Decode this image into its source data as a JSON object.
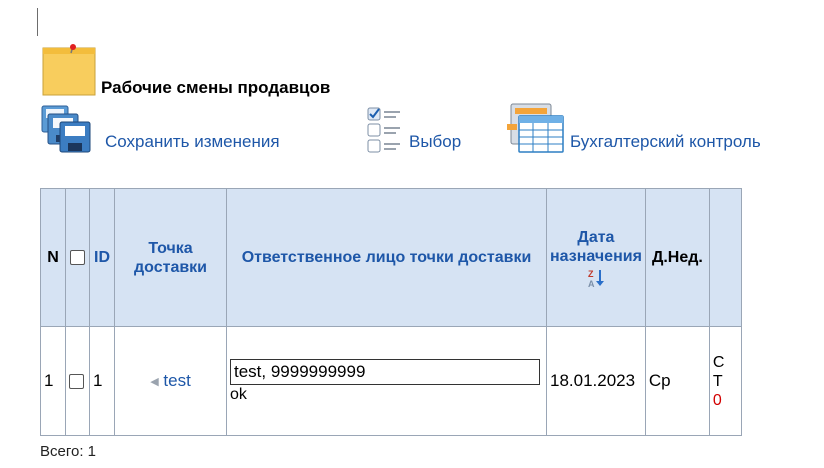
{
  "page": {
    "title": "Рабочие смены продавцов"
  },
  "toolbar": {
    "save_label": "Сохранить изменения",
    "select_label": "Выбор",
    "accounting_label": "Бухгалтерский контроль"
  },
  "table": {
    "headers": {
      "n": "N",
      "id": "ID",
      "point": "Точка доставки",
      "responsible": "Ответственное лицо точки доставки",
      "date": "Дата назначения",
      "weekday": "Д.Нед."
    },
    "rows": [
      {
        "n": "1",
        "id": "1",
        "point": "test",
        "responsible_value": "test, 9999999999",
        "responsible_note": "ok",
        "date": "18.01.2023",
        "weekday": "Ср",
        "extra_1": "С",
        "extra_2": "Т",
        "extra_3": "0"
      }
    ]
  },
  "footer": {
    "total": "Всего: 1"
  },
  "colors": {
    "link": "#1e57a8",
    "header_bg": "#d6e3f3",
    "border": "#9aa6b6",
    "alert": "#d20000"
  }
}
